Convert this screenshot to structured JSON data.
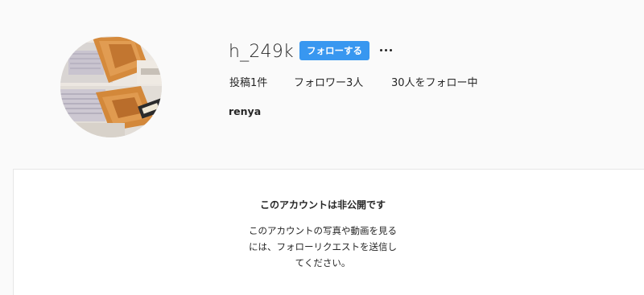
{
  "profile": {
    "username": "h_249k",
    "follow_label": "フォローする",
    "more_icon": "ellipsis-icon",
    "avatar_icon": "profile-photo",
    "stats": {
      "posts": "投稿1件",
      "followers": "フォロワー3人",
      "following": "30人をフォロー中"
    },
    "full_name": "renya"
  },
  "private_notice": {
    "title": "このアカウントは非公開です",
    "line1": "このアカウントの写真や動画を見る",
    "line2": "には、フォローリクエストを送信し",
    "line3": "てください。"
  },
  "colors": {
    "accent": "#3897f0",
    "background": "#fafafa",
    "card": "#ffffff",
    "text": "#262626"
  }
}
